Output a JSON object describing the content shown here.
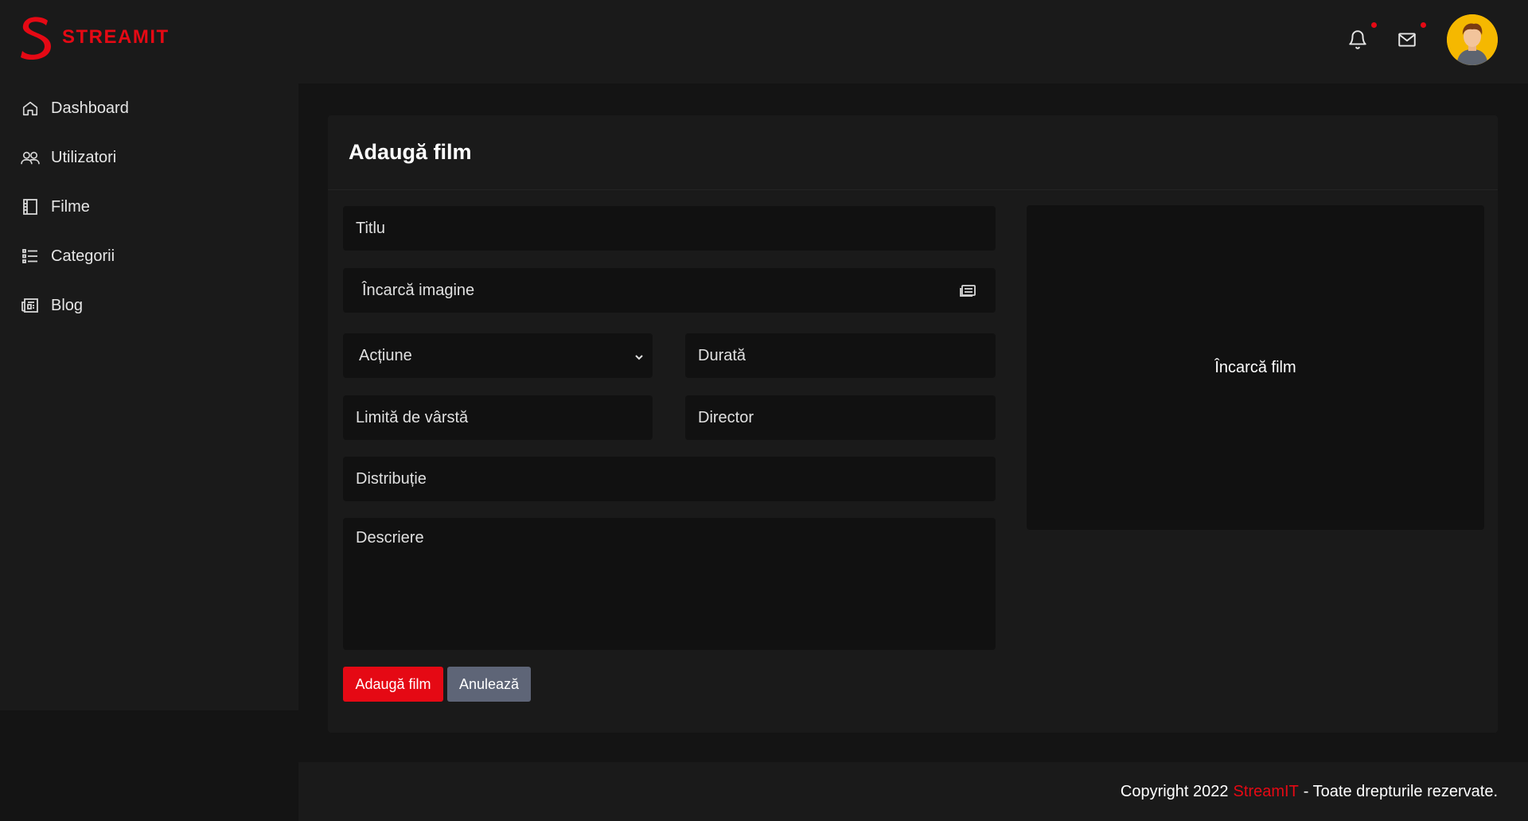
{
  "brand": {
    "name": "STREAMIT",
    "color": "#e50914"
  },
  "header": {
    "icons": [
      "bell-icon",
      "mail-icon"
    ],
    "notifications_dot": true,
    "messages_dot": true
  },
  "sidebar": {
    "items": [
      {
        "label": "Dashboard",
        "icon": "home-icon"
      },
      {
        "label": "Utilizatori",
        "icon": "users-icon"
      },
      {
        "label": "Filme",
        "icon": "film-icon"
      },
      {
        "label": "Categorii",
        "icon": "list-icon"
      },
      {
        "label": "Blog",
        "icon": "newspaper-icon"
      }
    ]
  },
  "form": {
    "title": "Adaugă film",
    "fields": {
      "titlu": "Titlu",
      "imagine": "Încarcă imagine",
      "categorie": "Acțiune",
      "durata": "Durată",
      "limita_varsta": "Limită de vârstă",
      "director": "Director",
      "distributie": "Distribuție",
      "descriere": "Descriere"
    },
    "upload_film_label": "Încarcă film",
    "submit_label": "Adaugă film",
    "cancel_label": "Anulează"
  },
  "footer": {
    "prefix": "Copyright 2022",
    "brand": "StreamIT",
    "suffix": "- Toate drepturile rezervate."
  }
}
